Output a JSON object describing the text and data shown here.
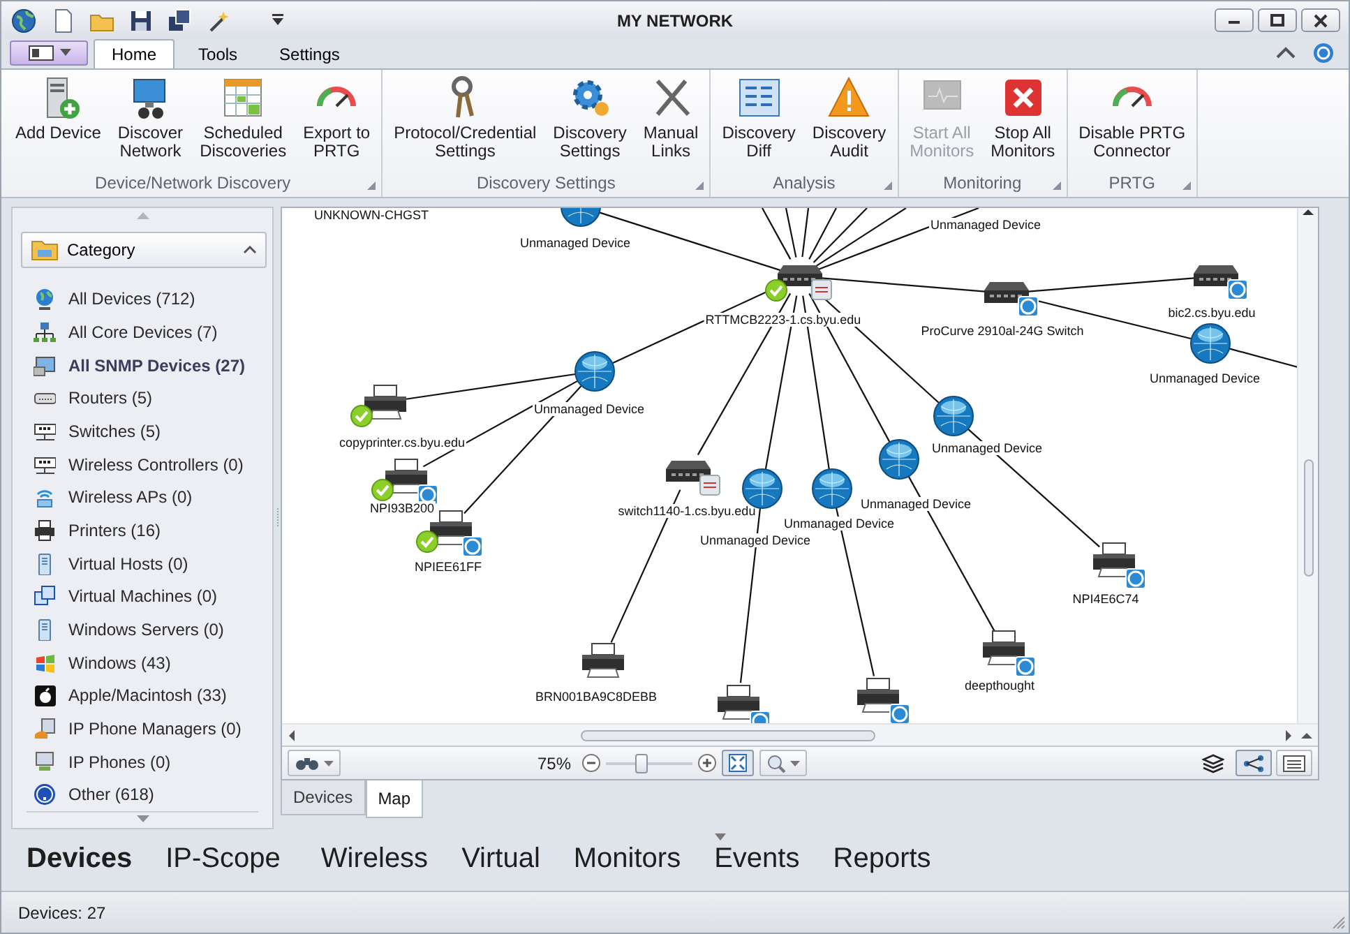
{
  "window": {
    "title": "MY NETWORK"
  },
  "ribbon_tabs": [
    {
      "label": "Home",
      "selected": true
    },
    {
      "label": "Tools",
      "selected": false
    },
    {
      "label": "Settings",
      "selected": false
    }
  ],
  "ribbon_groups": [
    {
      "label": "Device/Network Discovery",
      "buttons": [
        {
          "label": "Add Device",
          "disabled": false
        },
        {
          "label": "Discover\nNetwork",
          "disabled": false
        },
        {
          "label": "Scheduled\nDiscoveries",
          "disabled": false
        },
        {
          "label": "Export to\nPRTG",
          "disabled": false
        }
      ]
    },
    {
      "label": "Discovery Settings",
      "buttons": [
        {
          "label": "Protocol/Credential\nSettings",
          "disabled": false
        },
        {
          "label": "Discovery\nSettings",
          "disabled": false
        },
        {
          "label": "Manual\nLinks",
          "disabled": false
        }
      ]
    },
    {
      "label": "Analysis",
      "buttons": [
        {
          "label": "Discovery\nDiff",
          "disabled": false
        },
        {
          "label": "Discovery\nAudit",
          "disabled": false
        }
      ]
    },
    {
      "label": "Monitoring",
      "buttons": [
        {
          "label": "Start All\nMonitors",
          "disabled": true
        },
        {
          "label": "Stop All\nMonitors",
          "disabled": false
        }
      ]
    },
    {
      "label": "PRTG",
      "buttons": [
        {
          "label": "Disable PRTG\nConnector",
          "disabled": false
        }
      ]
    }
  ],
  "sidebar": {
    "header": "Category",
    "items": [
      {
        "label": "All Devices (712)",
        "selected": false
      },
      {
        "label": "All Core Devices (7)",
        "selected": false
      },
      {
        "label": "All SNMP Devices (27)",
        "selected": true
      },
      {
        "label": "Routers (5)",
        "selected": false
      },
      {
        "label": "Switches (5)",
        "selected": false
      },
      {
        "label": "Wireless Controllers (0)",
        "selected": false
      },
      {
        "label": "Wireless APs (0)",
        "selected": false
      },
      {
        "label": "Printers (16)",
        "selected": false
      },
      {
        "label": "Virtual Hosts (0)",
        "selected": false
      },
      {
        "label": "Virtual Machines (0)",
        "selected": false
      },
      {
        "label": "Windows Servers (0)",
        "selected": false
      },
      {
        "label": "Windows (43)",
        "selected": false
      },
      {
        "label": "Apple/Macintosh (33)",
        "selected": false
      },
      {
        "label": "IP Phone Managers (0)",
        "selected": false
      },
      {
        "label": "IP Phones (0)",
        "selected": false
      },
      {
        "label": "Other (618)",
        "selected": false
      }
    ]
  },
  "map": {
    "nodes": [
      {
        "kind": "offscreen",
        "label": "UNKNOWN-CHGST"
      },
      {
        "kind": "globe",
        "label": "Unmanaged Device"
      },
      {
        "kind": "offscreen",
        "label": "Unmanaged Device"
      },
      {
        "kind": "switch",
        "label": "RTTMCB2223-1.cs.byu.edu",
        "monitored": true,
        "snmp_badge": true
      },
      {
        "kind": "switch",
        "label": "ProCurve  2910al-24G Switch",
        "vendor_badge": true
      },
      {
        "kind": "switch",
        "label": "bic2.cs.byu.edu",
        "vendor_badge": true
      },
      {
        "kind": "globe",
        "label": "Unmanaged Device"
      },
      {
        "kind": "globe",
        "label": "Unmanaged Device"
      },
      {
        "kind": "printer",
        "label": "copyprinter.cs.byu.edu",
        "monitored": true
      },
      {
        "kind": "printer",
        "label": "NPI93B200",
        "monitored": true,
        "vendor_badge": true
      },
      {
        "kind": "printer",
        "label": "NPIEE61FF",
        "monitored": true,
        "vendor_badge": true
      },
      {
        "kind": "switch",
        "label": "switch1140-1.cs.byu.edu",
        "snmp_badge": true
      },
      {
        "kind": "globe",
        "label": "Unmanaged Device"
      },
      {
        "kind": "globe",
        "label": "Unmanaged Device"
      },
      {
        "kind": "globe",
        "label": "Unmanaged Device"
      },
      {
        "kind": "globe",
        "label": "Unmanaged Device"
      },
      {
        "kind": "printer",
        "label": "NPI4E6C74",
        "vendor_badge": true
      },
      {
        "kind": "printer",
        "label": "BRN001BA9C8DEBB"
      },
      {
        "kind": "printer",
        "label": "deepthought",
        "vendor_badge": true
      },
      {
        "kind": "printer",
        "vendor_badge": true
      },
      {
        "kind": "printer",
        "vendor_badge": true
      }
    ],
    "zoom": "75%",
    "zoom_slider": {
      "level": 0.4
    }
  },
  "view_tabs": [
    {
      "label": "Devices",
      "selected": false
    },
    {
      "label": "Map",
      "selected": true
    }
  ],
  "nav": [
    {
      "label": "Devices",
      "selected": true
    },
    {
      "label": "IP-Scope",
      "selected": false
    },
    {
      "label": "Wireless",
      "selected": false
    },
    {
      "label": "Virtual",
      "selected": false
    },
    {
      "label": "Monitors",
      "selected": false
    },
    {
      "label": "Events",
      "selected": false
    },
    {
      "label": "Reports",
      "selected": false
    }
  ],
  "status_bar": {
    "text": "Devices: 27"
  }
}
